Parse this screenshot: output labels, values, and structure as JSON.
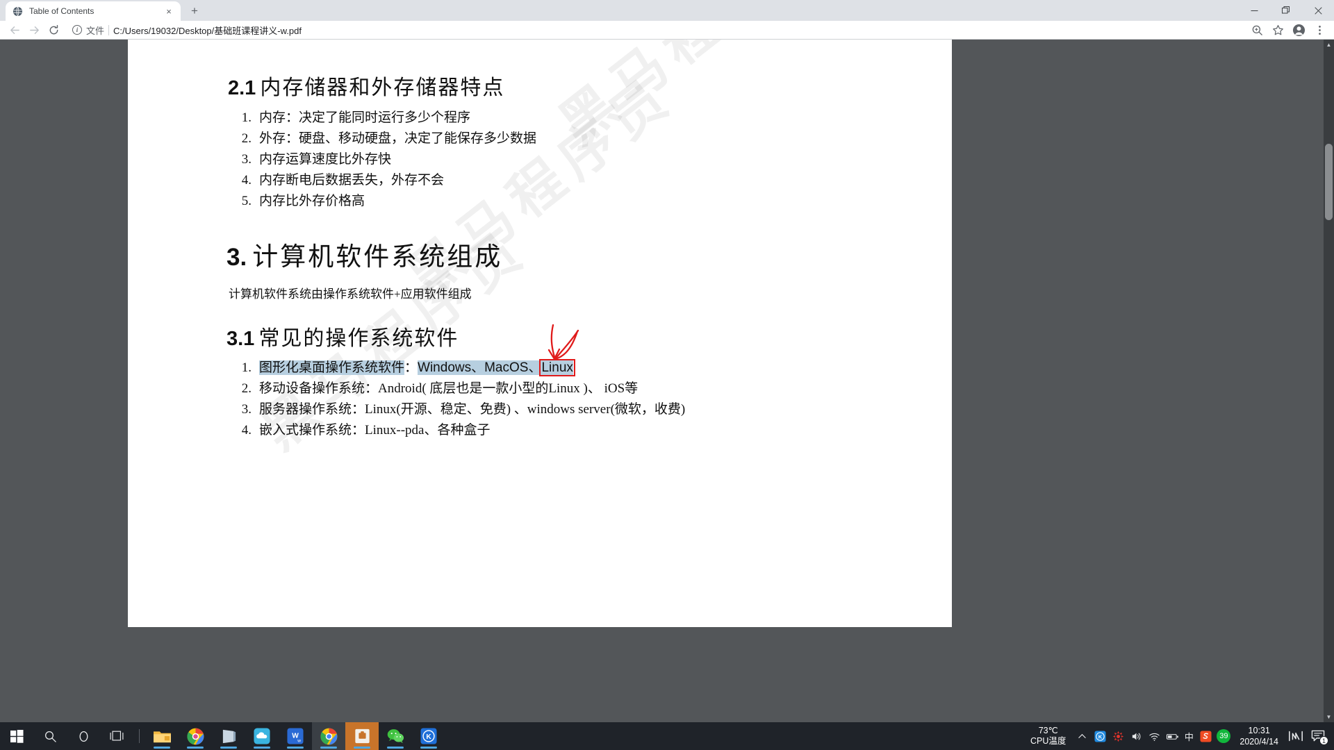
{
  "browser": {
    "tab": {
      "title": "Table of Contents",
      "favicon": "globe-icon",
      "close": "×"
    },
    "newtab_label": "+",
    "window_controls": {
      "minimize": "−",
      "maximize": "❐",
      "close": "✕"
    },
    "toolbar": {
      "back": "←",
      "forward": "→",
      "reload": "⟳",
      "info_glyph": "i",
      "scheme_label": "文件",
      "url": "C:/Users/19032/Desktop/基础班课程讲义-w.pdf",
      "zoom_icon": "zoom-in-icon",
      "bookmark_icon": "star-icon",
      "profile_icon": "profile-avatar-icon",
      "menu_icon": "kebab-menu-icon"
    }
  },
  "document": {
    "watermark_text": "黑马程序员",
    "section_2_1": {
      "num": "2.1",
      "title": "内存储器和外存储器特点"
    },
    "list_2_1": [
      {
        "n": "1.",
        "text": "内存：决定了能同时运行多少个程序"
      },
      {
        "n": "2.",
        "text": "外存：硬盘、移动硬盘，决定了能保存多少数据"
      },
      {
        "n": "3.",
        "text": "内存运算速度比外存快"
      },
      {
        "n": "4.",
        "text": "内存断电后数据丢失，外存不会"
      },
      {
        "n": "5.",
        "text": "内存比外存价格高"
      }
    ],
    "section_3": {
      "num": "3.",
      "title": "计算机软件系统组成"
    },
    "paragraph_3": "计算机软件系统由操作系统软件+应用软件组成",
    "section_3_1": {
      "num": "3.1",
      "title": "常见的操作系统软件"
    },
    "list_3_1": [
      {
        "n": "1.",
        "highlighted_prefix": "图形化桌面操作系统软件",
        "colon": "：",
        "highlighted_mid": "Windows、MacOS、",
        "boxed": "Linux"
      },
      {
        "n": "2.",
        "text": "移动设备操作系统：Android( 底层也是一款小型的Linux )、 iOS等"
      },
      {
        "n": "3.",
        "text": "服务器操作系统：Linux(开源、稳定、免费) 、windows server(微软，收费)"
      },
      {
        "n": "4.",
        "text": "嵌入式操作系统：Linux--pda、各种盒子"
      }
    ],
    "annotation": {
      "type": "red-arrow-and-box",
      "color": "#e01b1b",
      "target": "Linux"
    },
    "highlight_color": "#b7cfe0"
  },
  "taskbar": {
    "start": "start-button",
    "search": "search-icon",
    "cortana": "cortana-circle-icon",
    "taskview": "task-view-icon",
    "apps": [
      {
        "name": "file-explorer",
        "label": ""
      },
      {
        "name": "chrome-colorful",
        "label": ""
      },
      {
        "name": "notepad-app",
        "label": ""
      },
      {
        "name": "baidu-netdisk",
        "label": ""
      },
      {
        "name": "wps-writer",
        "label": "W"
      },
      {
        "name": "google-chrome",
        "label": ""
      },
      {
        "name": "pdf-reader-active",
        "label": ""
      },
      {
        "name": "wechat",
        "label": ""
      },
      {
        "name": "kugou-music",
        "label": "K"
      }
    ],
    "cpu_temp_value": "73℃",
    "cpu_temp_label": "CPU温度",
    "tray": [
      {
        "name": "chevron-up-icon",
        "glyph": "∧"
      },
      {
        "name": "kingsoft-icon",
        "glyph": "K"
      },
      {
        "name": "security-shield-icon",
        "glyph": "✿"
      },
      {
        "name": "volume-icon",
        "glyph": "🔊"
      },
      {
        "name": "wifi-icon",
        "glyph": "◠"
      },
      {
        "name": "battery-icon",
        "glyph": "▭"
      },
      {
        "name": "ime-chinese-icon",
        "glyph": "中"
      },
      {
        "name": "sogou-input-icon",
        "glyph": "S"
      },
      {
        "name": "weather-badge-icon",
        "glyph": "39"
      }
    ],
    "clock": {
      "time": "10:31",
      "date": "2020/4/14"
    },
    "network_monitor_icon": "network-speed-icon",
    "notification_icon": "action-center-icon",
    "notification_count": "1"
  }
}
